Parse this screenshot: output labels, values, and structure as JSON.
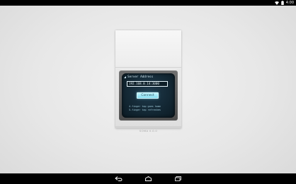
{
  "status_bar": {
    "time": "4:00",
    "icons": [
      "wifi-icon",
      "battery-icon"
    ]
  },
  "connect_panel": {
    "title": "Server Address",
    "address_value": "192.168.0.14:3000",
    "connect_label": "Connect",
    "hint_line_1": "4-finger tap goes home",
    "hint_line_2": "5-finger tap refreshes"
  },
  "version_label": "SOMA 0.0.0",
  "nav_bar": {
    "buttons": [
      "back-icon",
      "home-icon",
      "recent-apps-icon"
    ]
  },
  "colors": {
    "background": "#e7e7e7",
    "screen": "#132733",
    "accent": "#86dbee",
    "bar": "#000000"
  }
}
